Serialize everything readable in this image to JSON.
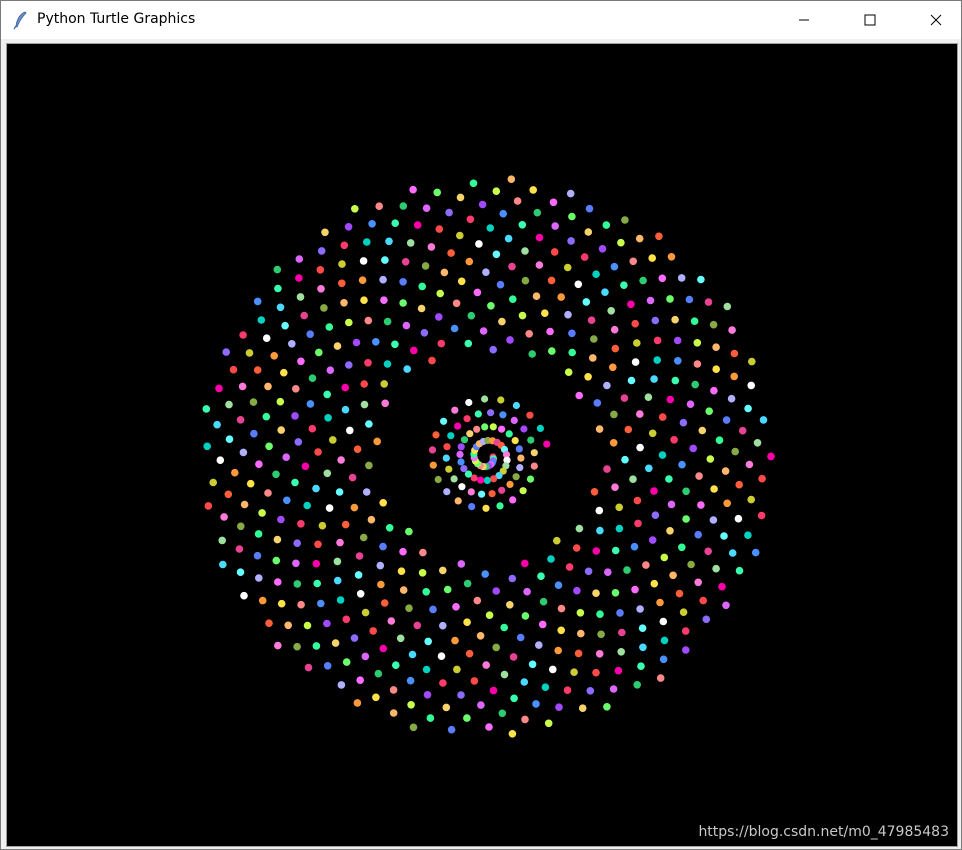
{
  "window": {
    "title": "Python Turtle Graphics",
    "icon": "feather-icon",
    "controls": [
      "minimize-icon",
      "maximize-icon",
      "close-icon"
    ]
  },
  "canvas": {
    "background": "#000000",
    "watermark": "https://blog.csdn.net/m0_47985483"
  },
  "spiral": {
    "palette": [
      "#ff3b6b",
      "#ffe14a",
      "#4ad9ff",
      "#6bff6b",
      "#ff7ad9",
      "#a14aff",
      "#ff9a3b",
      "#3bffb0",
      "#5a7dff",
      "#ff4a4a",
      "#c8ff4a",
      "#ffffff",
      "#2ecc71",
      "#e84393",
      "#8e6bff",
      "#ffb86b",
      "#00d1c1",
      "#ff6bff",
      "#9fe0a0",
      "#f7d36b",
      "#ff5e3a",
      "#4a90ff",
      "#b0b0ff",
      "#ff00aa",
      "#33ff99",
      "#cccc33",
      "#ff8888",
      "#66ffff",
      "#dd66ff",
      "#88aa44"
    ]
  }
}
